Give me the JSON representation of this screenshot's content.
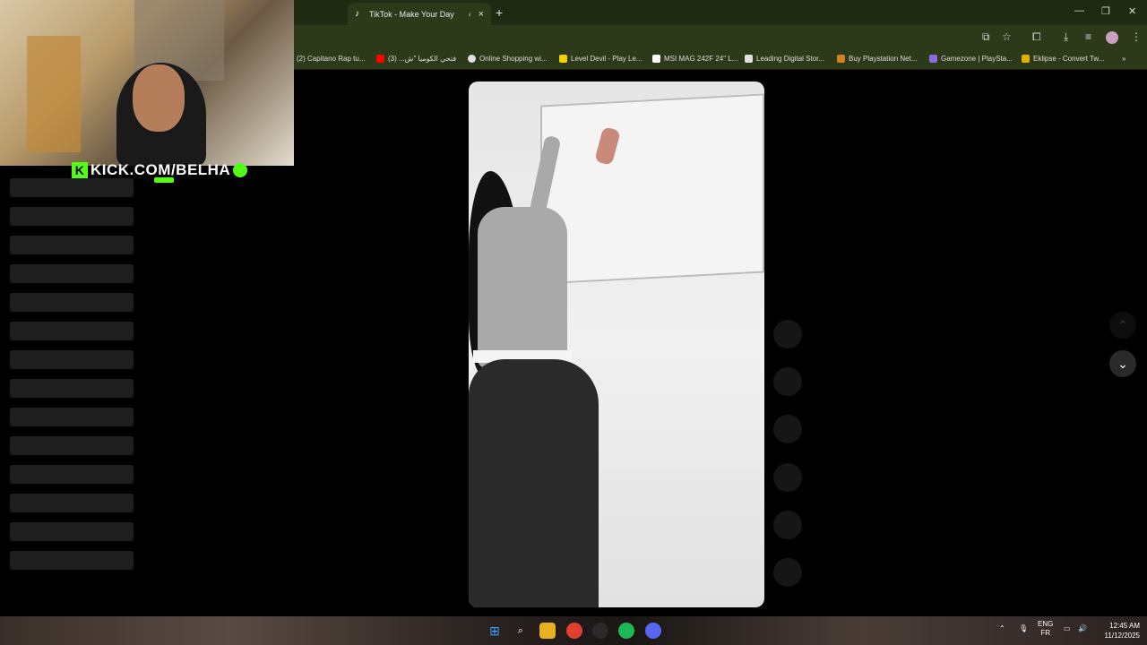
{
  "browser": {
    "tab_title": "TikTok - Make Your Day",
    "tab_icon": "tiktok-icon",
    "new_tab_glyph": "+",
    "close_glyph": "×",
    "mute_glyph": "◐"
  },
  "window_controls": {
    "minimize": "—",
    "restore": "❐",
    "close": "✕"
  },
  "bookmarks": [
    {
      "label": "(2) Capitano Rap tu...",
      "color": "#2c3a1a"
    },
    {
      "label": "فتحي الكوميا \"ش... (3)",
      "color": "#ff0000"
    },
    {
      "label": "Online Shopping wi...",
      "color": "#e0e0e0"
    },
    {
      "label": "Level Devil - Play Le...",
      "color": "#f5d000"
    },
    {
      "label": "MSI MAG 242F 24\" L...",
      "color": "#ffffff"
    },
    {
      "label": "Leading Digital Stor...",
      "color": "#e0e0e0"
    },
    {
      "label": "Buy Playstation Net...",
      "color": "#d08020"
    },
    {
      "label": "Gamezone | PlaySta...",
      "color": "#8a6ae0"
    },
    {
      "label": "Eklipse - Convert Tw...",
      "color": "#e0b000"
    }
  ],
  "bookmarks_overflow": "»",
  "stream": {
    "overlay_text": "KICK.COM/BELHA",
    "brand_letter": "K",
    "accent": "#53fc18"
  },
  "nav": {
    "up": "⌃",
    "down": "⌄"
  },
  "taskbar": {
    "language_top": "ENG",
    "language_bottom": "FR",
    "time": "12:45 AM",
    "date": "11/12/2025"
  }
}
